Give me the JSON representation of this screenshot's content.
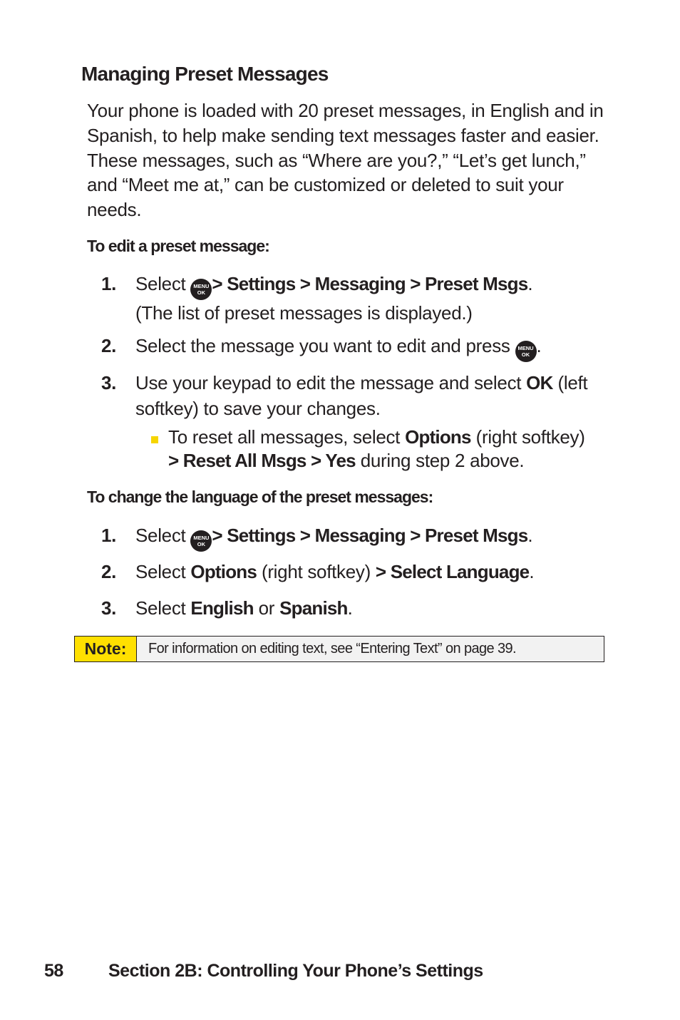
{
  "heading": "Managing Preset Messages",
  "intro": "Your phone is loaded with 20 preset messages, in English and in Spanish, to help make sending text messages faster and easier. These messages, such as “Where are you?,” “Let’s get lunch,” and “Meet me at,” can be customized or deleted to suit your needs.",
  "menu_key": {
    "line1": "MENU",
    "line2": "OK",
    "icon": "menu-ok-key-icon"
  },
  "edit_section": {
    "title": "To edit a preset message:",
    "steps": [
      {
        "num": "1.",
        "pre": "Select",
        "path": "> Settings > Messaging > Preset Msgs",
        "post": ".",
        "line2": "(The list of preset messages is displayed.)"
      },
      {
        "num": "2.",
        "pre": "Select the message you want to edit and press",
        "post": "."
      },
      {
        "num": "3.",
        "pre": "Use your keypad to edit the message and select",
        "bold": "OK",
        "post": "(left softkey) to save your changes."
      }
    ],
    "bullet": {
      "pre": "To reset all messages, select",
      "bold1": "Options",
      "mid": "(right softkey)",
      "bold2": "> Reset All Msgs > Yes",
      "post": "during step 2 above."
    }
  },
  "language_section": {
    "title": "To change the language of the preset messages:",
    "steps": [
      {
        "num": "1.",
        "pre": "Select",
        "path": "> Settings > Messaging > Preset Msgs",
        "post": "."
      },
      {
        "num": "2.",
        "pre": "Select",
        "bold1": "Options",
        "mid": "(right softkey)",
        "bold2": "> Select Language",
        "post": "."
      },
      {
        "num": "3.",
        "pre": "Select",
        "bold1": "English",
        "mid": "or",
        "bold2": "Spanish",
        "post": "."
      }
    ]
  },
  "note": {
    "label": "Note:",
    "text": "For information on editing text, see “Entering Text” on page 39."
  },
  "footer": {
    "page_number": "58",
    "section": "Section 2B: Controlling Your Phone’s Settings"
  },
  "colors": {
    "note_label_bg": "#ffe000",
    "bullet": "#f6d500",
    "note_text_bg": "#f2f2f2"
  }
}
